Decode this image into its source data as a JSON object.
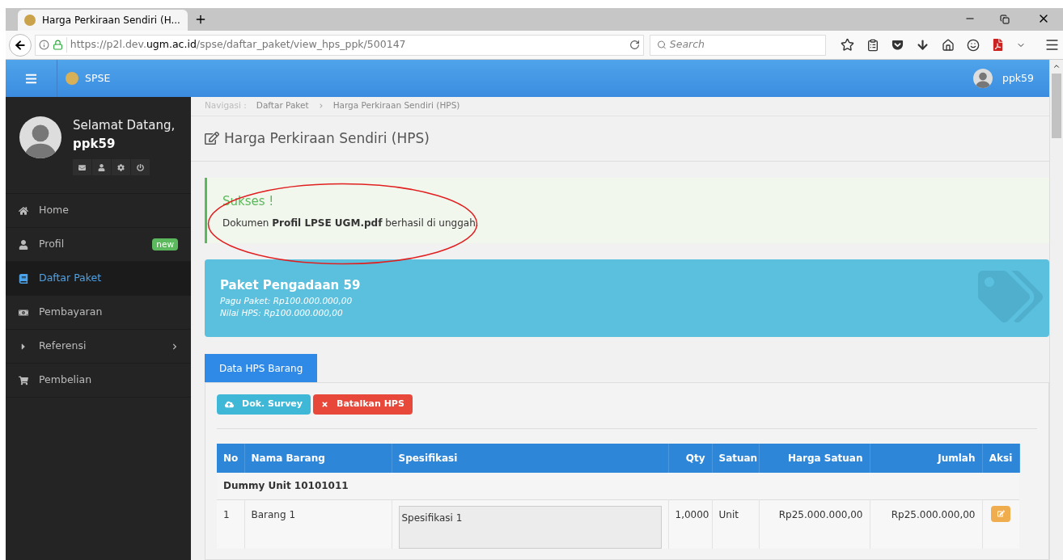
{
  "browser": {
    "tab_title": "Harga Perkiraan Sendiri (H...",
    "url_prefix": "https://p2l.dev.",
    "url_domain": "ugm.ac.id",
    "url_path": "/spse/daftar_paket/view_hps_ppk/500147",
    "search_placeholder": "Search"
  },
  "header": {
    "brand": "SPSE",
    "user": "ppk59"
  },
  "sidebar": {
    "greeting": "Selamat Datang,",
    "username": "ppk59",
    "items": [
      {
        "label": "Home",
        "selected": false,
        "expandable": false
      },
      {
        "label": "Profil",
        "selected": false,
        "expandable": false,
        "badge": "new"
      },
      {
        "label": "Daftar Paket",
        "selected": true,
        "expandable": false
      },
      {
        "label": "Pembayaran",
        "selected": false,
        "expandable": false
      },
      {
        "label": "Referensi",
        "selected": false,
        "expandable": true
      },
      {
        "label": "Pembelian",
        "selected": false,
        "expandable": false
      }
    ]
  },
  "breadcrumb": {
    "label": "Navigasi :",
    "items": [
      "Daftar Paket",
      "Harga Perkiraan Sendiri (HPS)"
    ]
  },
  "page_title": "Harga Perkiraan Sendiri (HPS)",
  "alert": {
    "title": "Sukses !",
    "message": "Dokumen **Profil LPSE UGM.pdf** berhasil di unggah."
  },
  "package": {
    "title": "Paket Pengadaan 59",
    "lines": [
      "Pagu Paket: Rp100.000.000,00",
      "Nilai HPS: Rp100.000.000,00"
    ]
  },
  "tabs": [
    {
      "label": "Data HPS Barang",
      "selected": true
    }
  ],
  "buttons": [
    {
      "label": "Dok. Survey",
      "kind": "info"
    },
    {
      "label": "Batalkan HPS",
      "kind": "danger"
    }
  ],
  "table": {
    "columns": [
      "No",
      "Nama Barang",
      "Spesifikasi",
      "Qty",
      "Satuan",
      "Harga Satuan",
      "Jumlah",
      "Aksi"
    ],
    "groups": [
      {
        "title": "Dummy Unit 10101011",
        "rows": [
          {
            "no": "1",
            "name": "Barang 1",
            "spec": "Spesifikasi 1",
            "qty": "1,0000",
            "unit": "Unit",
            "price": "Rp25.000.000,00",
            "total": "Rp25.000.000,00"
          }
        ]
      }
    ]
  }
}
